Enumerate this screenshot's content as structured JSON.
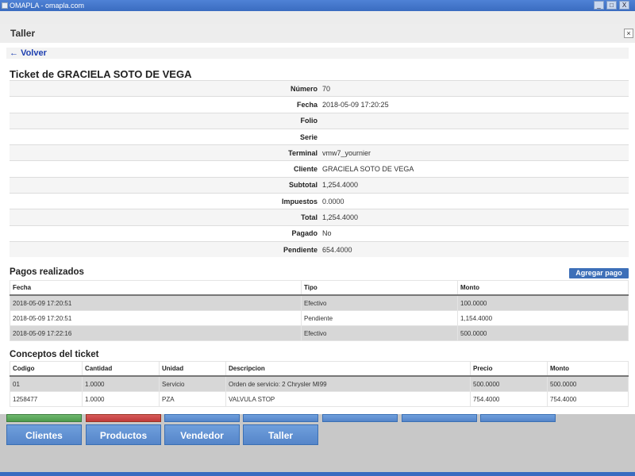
{
  "window": {
    "title": "OMAPLA - omapla.com",
    "controls": {
      "minimize": "_",
      "maximize": "□",
      "close": "X"
    }
  },
  "background": {
    "buttons_row1": [
      {
        "label": ""
      },
      {
        "label": ""
      },
      {
        "label": ""
      },
      {
        "label": ""
      },
      {
        "label": ""
      },
      {
        "label": ""
      },
      {
        "label": ""
      }
    ],
    "buttons_row2": [
      {
        "label": "Clientes"
      },
      {
        "label": "Productos"
      },
      {
        "label": "Vendedor"
      },
      {
        "label": "Taller"
      }
    ]
  },
  "modal": {
    "title": "Taller",
    "close_label": "×",
    "back_label": "Volver",
    "back_icon": "←"
  },
  "ticket": {
    "title": "Ticket de GRACIELA SOTO DE VEGA",
    "fields": [
      {
        "label": "Número",
        "value": "70"
      },
      {
        "label": "Fecha",
        "value": "2018-05-09 17:20:25"
      },
      {
        "label": "Folio",
        "value": ""
      },
      {
        "label": "Serie",
        "value": ""
      },
      {
        "label": "Terminal",
        "value": "vmw7_yournier"
      },
      {
        "label": "Cliente",
        "value": "GRACIELA SOTO DE VEGA"
      },
      {
        "label": "Subtotal",
        "value": "1,254.4000"
      },
      {
        "label": "Impuestos",
        "value": "0.0000"
      },
      {
        "label": "Total",
        "value": "1,254.4000"
      },
      {
        "label": "Pagado",
        "value": "No"
      },
      {
        "label": "Pendiente",
        "value": "654.4000"
      }
    ]
  },
  "payments": {
    "title": "Pagos realizados",
    "add_label": "Agregar pago",
    "columns": [
      "Fecha",
      "Tipo",
      "Monto"
    ],
    "rows": [
      [
        "2018-05-09 17:20:51",
        "Efectivo",
        "100.0000"
      ],
      [
        "2018-05-09 17:20:51",
        "Pendiente",
        "1,154.4000"
      ],
      [
        "2018-05-09 17:22:16",
        "Efectivo",
        "500.0000"
      ]
    ]
  },
  "concepts": {
    "title": "Conceptos del ticket",
    "columns": [
      "Codigo",
      "Cantidad",
      "Unidad",
      "Descripcion",
      "Precio",
      "Monto"
    ],
    "rows": [
      [
        "01",
        "1.0000",
        "Servicio",
        "Orden de servicio: 2 Chrysler MI99",
        "500.0000",
        "500.0000"
      ],
      [
        "1258477",
        "1.0000",
        "PZA",
        "VALVULA STOP",
        "754.4000",
        "754.4000"
      ]
    ]
  }
}
